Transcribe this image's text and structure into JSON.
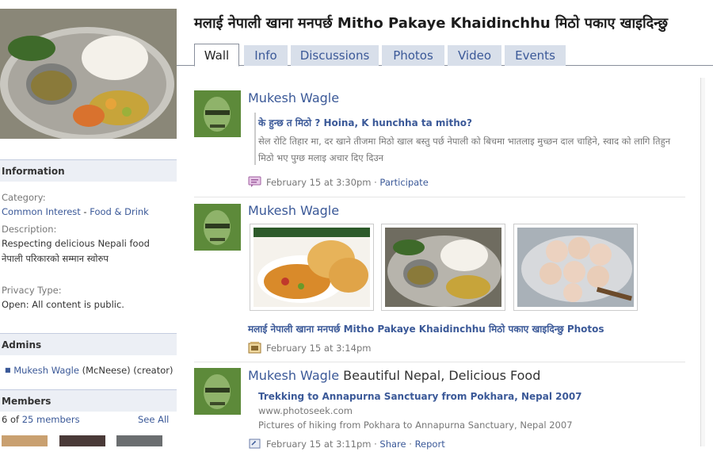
{
  "group": {
    "title": "मलाई नेपाली खाना मनपर्छ Mitho Pakaye Khaidinchhu मिठो पकाए खाइदिन्छु"
  },
  "tabs": [
    "Wall",
    "Info",
    "Discussions",
    "Photos",
    "Video",
    "Events"
  ],
  "sidebar": {
    "information_header": "Information",
    "category_label": "Category:",
    "category_link1": "Common Interest",
    "category_sep": " - ",
    "category_link2": "Food & Drink",
    "description_label": "Description:",
    "description_line1": "Respecting delicious Nepali food",
    "description_line2": "नेपाली परिकारको सम्मान स्वोरुप",
    "privacy_label": "Privacy Type:",
    "privacy_value": "Open: All content is public.",
    "admins_header": "Admins",
    "admin_name": "Mukesh Wagle",
    "admin_suffix": " (McNeese) (creator)",
    "members_header": "Members",
    "members_count_prefix": "6 of ",
    "members_count_link": "25 members",
    "see_all": "See All"
  },
  "stories": [
    {
      "actor": "Mukesh Wagle",
      "attachment_title": "के हुन्छ त मिठो ? Hoina, K hunchha ta mitho?",
      "attachment_desc": "सेल रोटि तिहार मा, दर खाने तीजमा मिठो खाल बस्तु पर्छ नेपाली को बिचमा भातलाइ मुच्छन दाल चाहिने, स्वाद को लागि तिहुन मिठो भए पुग्छ मलाइ अचार दिए दिउन",
      "time": "February 15 at 3:30pm",
      "action": "Participate",
      "sep": " · "
    },
    {
      "actor": "Mukesh Wagle",
      "album_link": "मलाई नेपाली खाना मनपर्छ Mitho Pakaye Khaidinchhu मिठो पकाए खाइदिन्छु Photos",
      "time": "February 15 at 3:14pm"
    },
    {
      "actor": "Mukesh Wagle",
      "message": " Beautiful Nepal, Delicious Food",
      "attachment_title": "Trekking to Annapurna Sanctuary from Pokhara, Nepal 2007",
      "attachment_domain": "www.photoseek.com",
      "attachment_desc": "Pictures of hiking from Pokhara to Annapurna Sanctuary, Nepal 2007",
      "time": "February 15 at 3:11pm",
      "action1": "Share",
      "action2": "Report",
      "sep": " · "
    }
  ],
  "colors": {
    "link": "#3b5998",
    "tab_bg": "#d8dfea",
    "section_bg": "#eceff5"
  }
}
